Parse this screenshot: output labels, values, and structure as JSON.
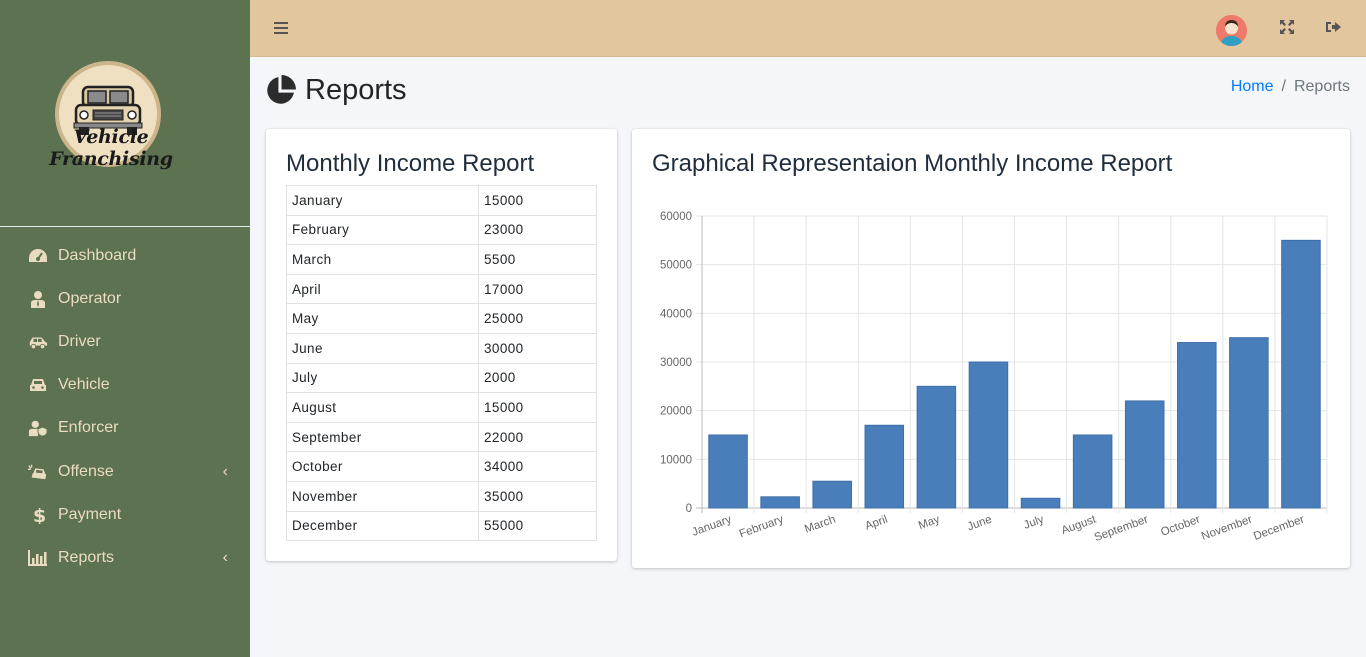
{
  "brand": {
    "name": "Vehicle Franchising"
  },
  "sidebar": {
    "items": [
      {
        "label": "Dashboard",
        "icon": "tachometer-icon",
        "chevron": false
      },
      {
        "label": "Operator",
        "icon": "user-tie-icon",
        "chevron": false
      },
      {
        "label": "Driver",
        "icon": "car-side-icon",
        "chevron": false
      },
      {
        "label": "Vehicle",
        "icon": "car-icon",
        "chevron": false
      },
      {
        "label": "Enforcer",
        "icon": "user-shield-icon",
        "chevron": false
      },
      {
        "label": "Offense",
        "icon": "car-crash-icon",
        "chevron": true
      },
      {
        "label": "Payment",
        "icon": "dollar-icon",
        "chevron": false
      },
      {
        "label": "Reports",
        "icon": "chart-bar-icon",
        "chevron": true
      }
    ],
    "chevron_glyph": "‹"
  },
  "header": {
    "title": "Reports",
    "breadcrumb": {
      "home": "Home",
      "separator": "/",
      "current": "Reports"
    }
  },
  "income_card": {
    "title": "Monthly Income Report",
    "rows": [
      {
        "month": "January",
        "amount": "15000"
      },
      {
        "month": "February",
        "amount": "23000"
      },
      {
        "month": "March",
        "amount": "5500"
      },
      {
        "month": "April",
        "amount": "17000"
      },
      {
        "month": "May",
        "amount": "25000"
      },
      {
        "month": "June",
        "amount": "30000"
      },
      {
        "month": "July",
        "amount": "2000"
      },
      {
        "month": "August",
        "amount": "15000"
      },
      {
        "month": "September",
        "amount": "22000"
      },
      {
        "month": "October",
        "amount": "34000"
      },
      {
        "month": "November",
        "amount": "35000"
      },
      {
        "month": "December",
        "amount": "55000"
      }
    ]
  },
  "chart_card": {
    "title": "Graphical Representaion Monthly Income Report"
  },
  "chart_data": {
    "type": "bar",
    "title": "",
    "xlabel": "",
    "ylabel": "",
    "categories": [
      "January",
      "February",
      "March",
      "April",
      "May",
      "June",
      "July",
      "August",
      "September",
      "October",
      "November",
      "December"
    ],
    "values": [
      15000,
      2300,
      5500,
      17000,
      25000,
      30000,
      2000,
      15000,
      22000,
      34000,
      35000,
      55000
    ],
    "ylim": [
      0,
      60000
    ],
    "yticks": [
      "0",
      "10000",
      "20000",
      "30000",
      "40000",
      "50000",
      "60000"
    ],
    "grid": true,
    "bar_color": "#4a7ebb"
  },
  "colors": {
    "sidebar_bg": "#5c7250",
    "topbar_bg": "#e2c69e",
    "sidebar_text": "#eadcc0",
    "link": "#007bff"
  }
}
